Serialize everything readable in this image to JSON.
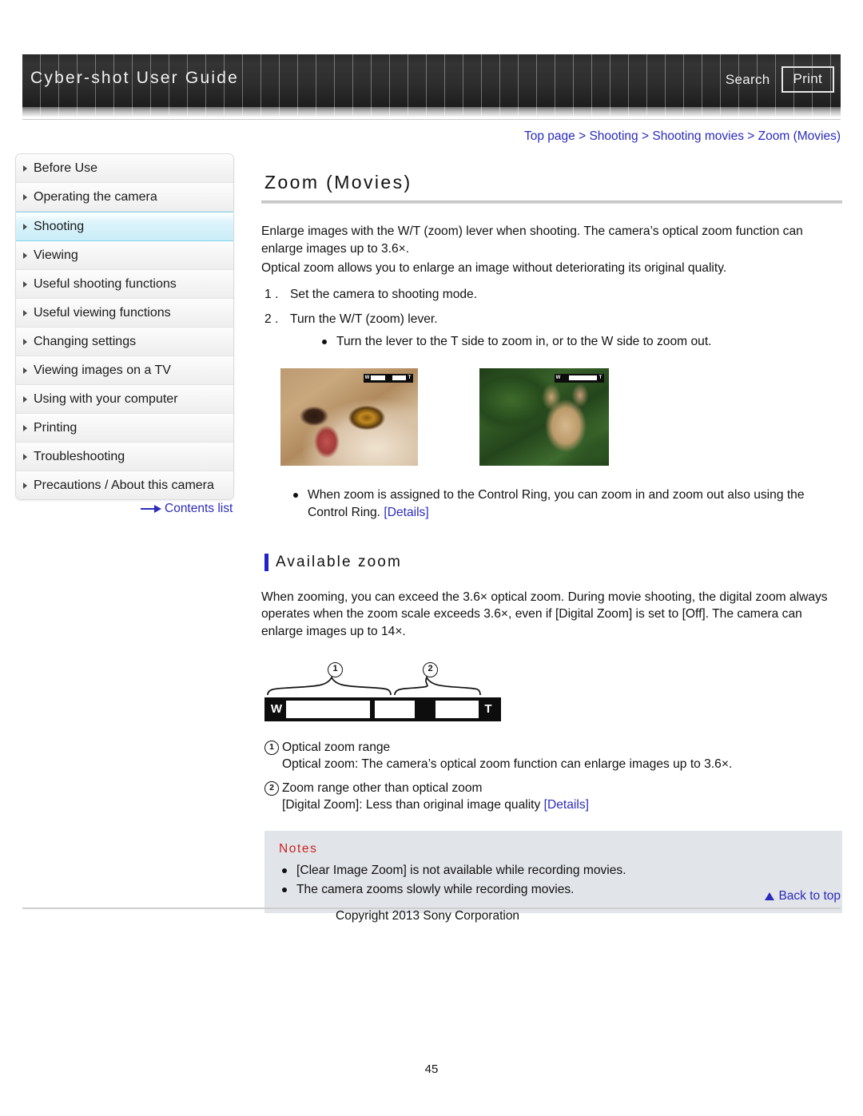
{
  "header": {
    "site_title": "Cyber-shot User Guide",
    "search_label": "Search",
    "print_label": "Print"
  },
  "breadcrumb": {
    "items": [
      "Top page",
      "Shooting",
      "Shooting movies",
      "Zoom (Movies)"
    ],
    "separator": ">",
    "full_text": "Top page > Shooting > Shooting movies > Zoom (Movies)"
  },
  "sidebar": {
    "items": [
      {
        "label": "Before Use",
        "active": false
      },
      {
        "label": "Operating the camera",
        "active": false
      },
      {
        "label": "Shooting",
        "active": true
      },
      {
        "label": "Viewing",
        "active": false
      },
      {
        "label": "Useful shooting functions",
        "active": false
      },
      {
        "label": "Useful viewing functions",
        "active": false
      },
      {
        "label": "Changing settings",
        "active": false
      },
      {
        "label": "Viewing images on a TV",
        "active": false
      },
      {
        "label": "Using with your computer",
        "active": false
      },
      {
        "label": "Printing",
        "active": false
      },
      {
        "label": "Troubleshooting",
        "active": false
      },
      {
        "label": "Precautions / About this camera",
        "active": false
      }
    ],
    "contents_link": "Contents list"
  },
  "main": {
    "title": "Zoom (Movies)",
    "intro_1": "Enlarge images with the W/T (zoom) lever when shooting. The camera’s optical zoom function can enlarge images up to 3.6×.",
    "intro_2": "Optical zoom allows you to enlarge an image without deteriorating its original quality.",
    "steps": [
      {
        "num": "1 .",
        "text": "Set the camera to shooting mode."
      },
      {
        "num": "2 .",
        "text": "Turn the W/T (zoom) lever."
      }
    ],
    "step2_bullet": "Turn the lever to the T side to zoom in, or to the W side to zoom out.",
    "photos": [
      {
        "caption": "telephoto-zoomed cat close-up",
        "zoom_w": "W",
        "zoom_t": "T"
      },
      {
        "caption": "wide-angle cat in foliage",
        "zoom_w": "W",
        "zoom_t": "T"
      }
    ],
    "control_ring_note": "When zoom is assigned to the Control Ring, you can zoom in and zoom out also using the Control Ring.",
    "control_ring_link": "[Details]",
    "section_title": "Available zoom",
    "available_zoom_text": "When zooming, you can exceed the 3.6× optical zoom. During movie shooting, the digital zoom always operates when the zoom scale exceeds 3.6×, even if [Digital Zoom] is set to [Off]. The camera can enlarge images up to 14×.",
    "diagram": {
      "marker_1": "1",
      "marker_2": "2",
      "wide_label": "W",
      "tele_label": "T"
    },
    "legend": [
      {
        "num": "1",
        "head": "Optical zoom range",
        "sub": "Optical zoom: The camera’s optical zoom function can enlarge images up to 3.6×."
      },
      {
        "num": "2",
        "head": "Zoom range other than optical zoom",
        "sub_pre": "[Digital Zoom]: Less than original image quality ",
        "sub_link": "[Details]"
      }
    ],
    "notes": {
      "title": "Notes",
      "items": [
        "[Clear Image Zoom] is not available while recording movies.",
        "The camera zooms slowly while recording movies."
      ]
    }
  },
  "footer": {
    "back_to_top": "Back to top",
    "copyright": "Copyright 2013 Sony Corporation",
    "page_number": "45"
  },
  "colors": {
    "link": "#2b2bbd",
    "notes_title": "#cc2222",
    "section_bar": "#2222cc",
    "active_nav": "#c9edf8"
  }
}
